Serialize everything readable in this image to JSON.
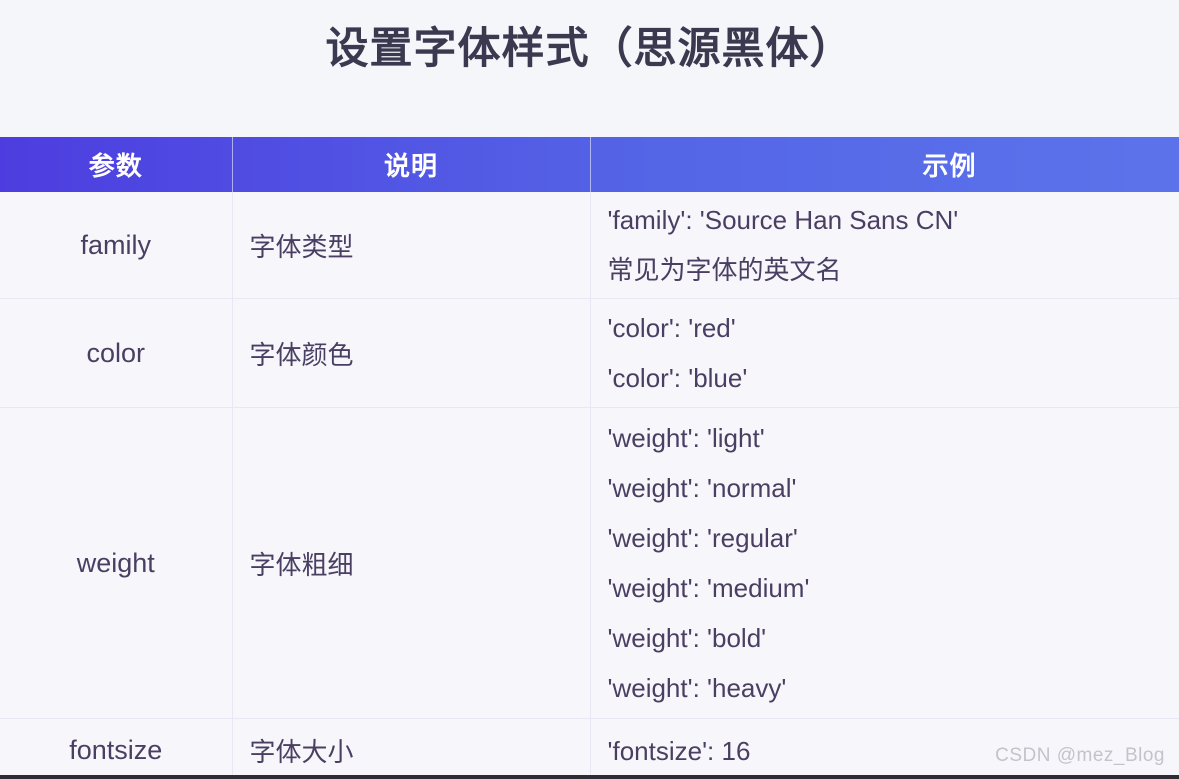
{
  "title": "设置字体样式（思源黑体）",
  "table": {
    "headers": {
      "param": "参数",
      "description": "说明",
      "example": "示例"
    },
    "rows": [
      {
        "param": "family",
        "description": "字体类型",
        "examples": [
          "'family': 'Source Han Sans CN'",
          "常见为字体的英文名"
        ]
      },
      {
        "param": "color",
        "description": "字体颜色",
        "examples": [
          "'color': 'red'",
          "'color': 'blue'"
        ]
      },
      {
        "param": "weight",
        "description": "字体粗细",
        "examples": [
          "'weight': 'light'",
          "'weight': 'normal'",
          "'weight': 'regular'",
          "'weight': 'medium'",
          "'weight': 'bold'",
          "'weight': 'heavy'"
        ]
      },
      {
        "param": "fontsize",
        "description": "字体大小",
        "examples": [
          "'fontsize': 16"
        ]
      }
    ]
  },
  "watermark": "CSDN @mez_Blog",
  "colors": {
    "page_background": "#f5f6fa",
    "title_text": "#3a3950",
    "header_gradient_start": "#4d3de0",
    "header_gradient_end": "#5e78ee",
    "header_text": "#ffffff",
    "body_text": "#4a3f63",
    "cell_background": "#f7f7fb",
    "border": "#e8e8f4",
    "watermark_text": "#c3c3cb"
  }
}
